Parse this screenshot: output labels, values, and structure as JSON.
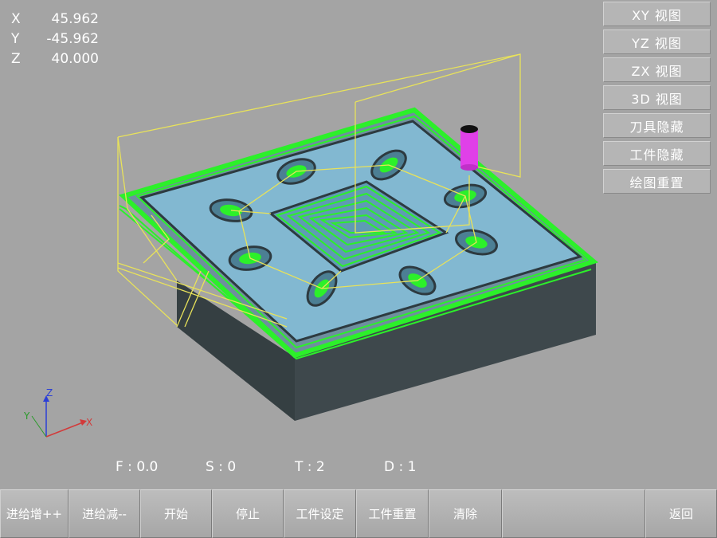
{
  "coords": {
    "x_label": "X",
    "x_value": "45.962",
    "y_label": "Y",
    "y_value": "-45.962",
    "z_label": "Z",
    "z_value": "40.000"
  },
  "view_buttons": {
    "xy": "XY 视图",
    "yz": "YZ 视图",
    "zx": "ZX 视图",
    "v3d": "3D 视图",
    "hide_tool": "刀具隐藏",
    "hide_workpiece": "工件隐藏",
    "reset_drawing": "绘图重置"
  },
  "status": {
    "f": "F : 0.0",
    "s": "S : 0",
    "t": "T : 2",
    "d": "D : 1"
  },
  "toolbar": {
    "feed_inc": "进给增++",
    "feed_dec": "进给减--",
    "start": "开始",
    "stop": "停止",
    "workpiece_settings": "工件设定",
    "workpiece_reset": "工件重置",
    "clear": "清除",
    "blank": "",
    "back": "返回"
  },
  "axis_indicator": {
    "x": "X",
    "y": "Y",
    "z": "Z"
  },
  "colors": {
    "background": "#a4a4a4",
    "workpiece_top": "#7fb6cf",
    "workpiece_side": "#3a4447",
    "toolpath_cut": "#2cf02a",
    "toolpath_rapid": "#e8e25a",
    "tool": "#e040e8",
    "axis_x": "#d23a3a",
    "axis_y": "#2a9a2a",
    "axis_z": "#2b3fd6"
  }
}
